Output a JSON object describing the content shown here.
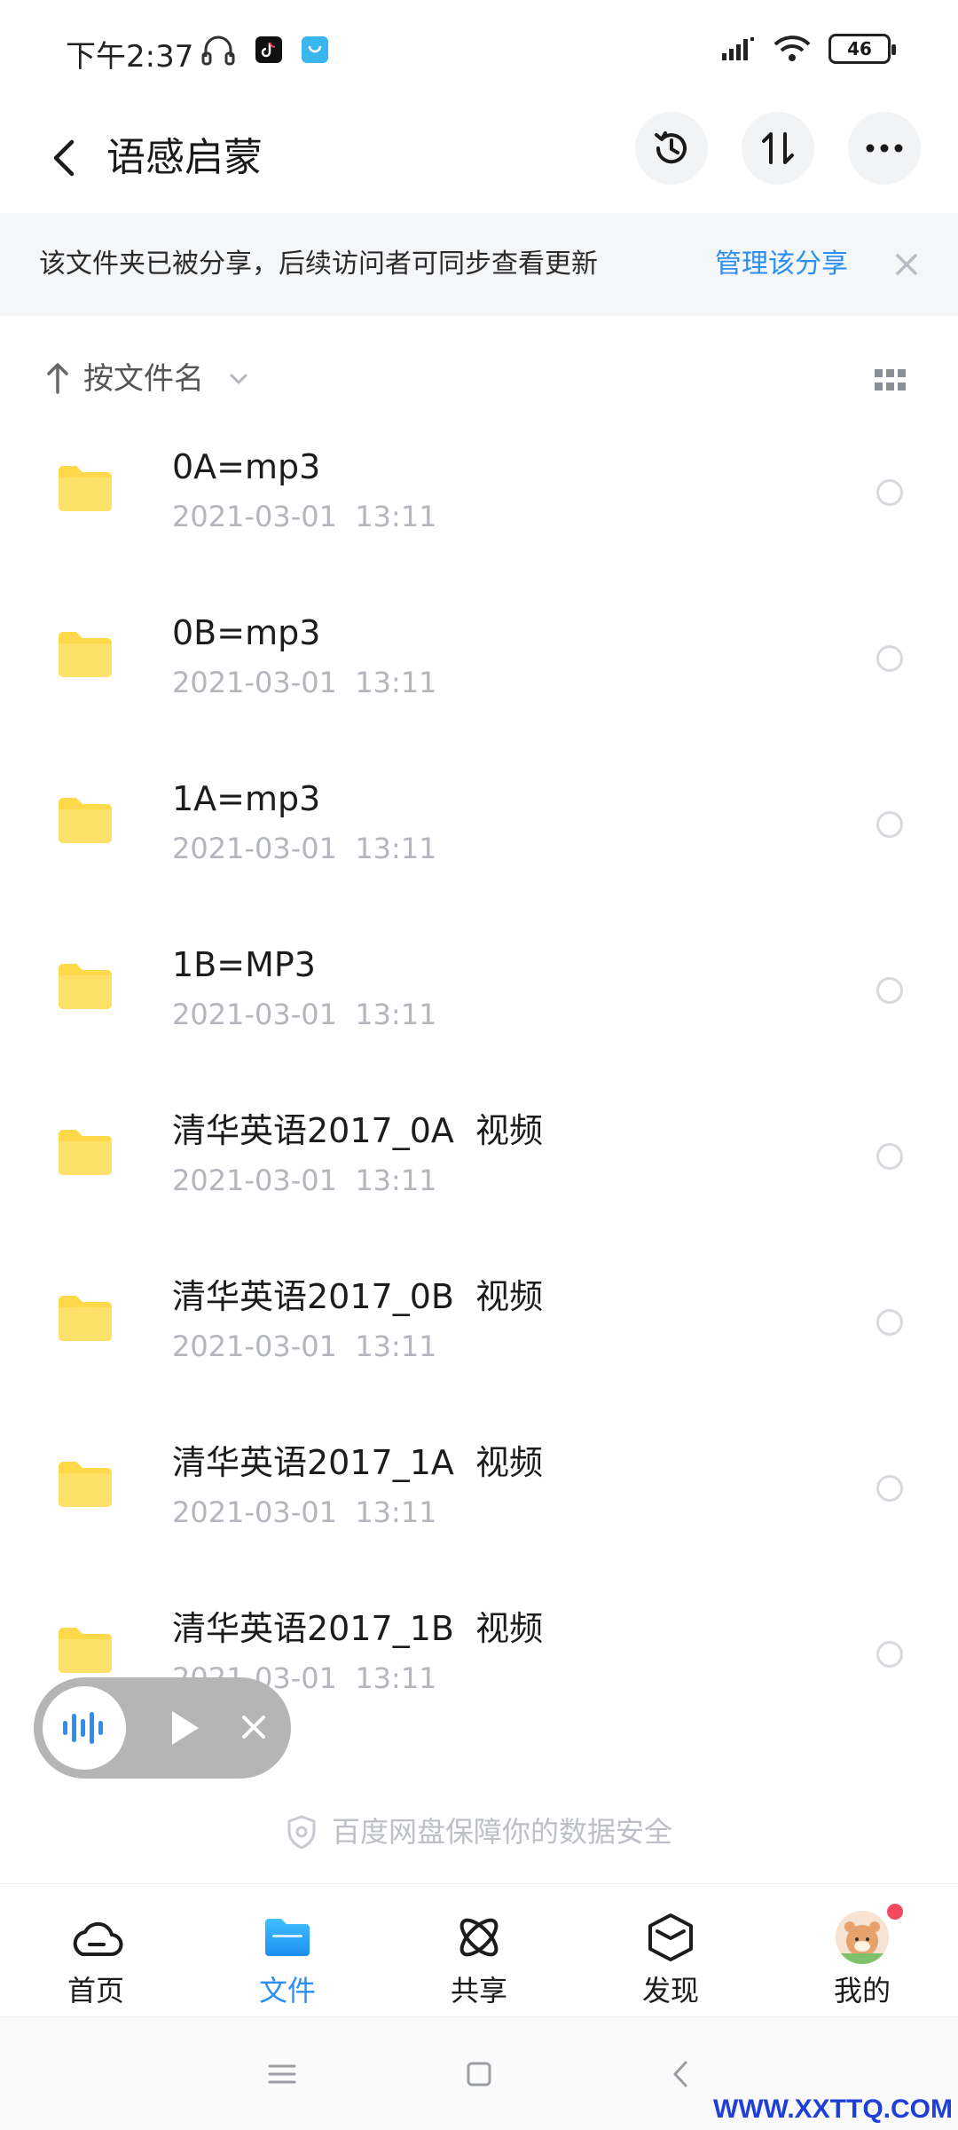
{
  "status_bar": {
    "time": "下午2:37",
    "battery": "46",
    "icons": [
      "headphones-icon",
      "tiktok-icon",
      "shopping-bag-icon",
      "signal-icon",
      "wifi-icon",
      "battery-icon"
    ]
  },
  "header": {
    "title": "语感启蒙",
    "buttons": [
      "back-icon",
      "history-icon",
      "sort-swap-icon",
      "more-icon"
    ]
  },
  "share_banner": {
    "text": "该文件夹已被分享，后续访问者可同步查看更新",
    "manage_label": "管理该分享"
  },
  "sort_bar": {
    "label": "按文件名"
  },
  "files": [
    {
      "name": "0A=mp3",
      "date": "2021-03-01  13:11"
    },
    {
      "name": "0B=mp3",
      "date": "2021-03-01  13:11"
    },
    {
      "name": "1A=mp3",
      "date": "2021-03-01  13:11"
    },
    {
      "name": "1B=MP3",
      "date": "2021-03-01  13:11"
    },
    {
      "name": "清华英语2017_0A  视频",
      "date": "2021-03-01  13:11"
    },
    {
      "name": "清华英语2017_0B  视频",
      "date": "2021-03-01  13:11"
    },
    {
      "name": "清华英语2017_1A  视频",
      "date": "2021-03-01  13:11"
    },
    {
      "name": "清华英语2017_1B  视频",
      "date": "2021-03-01  13:11"
    }
  ],
  "safety_note": "百度网盘保障你的数据安全",
  "bottom_nav": [
    {
      "label": "首页",
      "icon": "cloud-home-icon"
    },
    {
      "label": "文件",
      "icon": "folder-icon",
      "active": true
    },
    {
      "label": "共享",
      "icon": "atom-share-icon"
    },
    {
      "label": "发现",
      "icon": "cube-discover-icon"
    },
    {
      "label": "我的",
      "icon": "avatar-icon"
    }
  ],
  "watermark": "WWW.XXTTQ.COM",
  "colors": {
    "accent": "#2a8ef3",
    "folder": "#ffd94a",
    "muted": "#b3b6bc",
    "badge": "#f24a5f"
  }
}
